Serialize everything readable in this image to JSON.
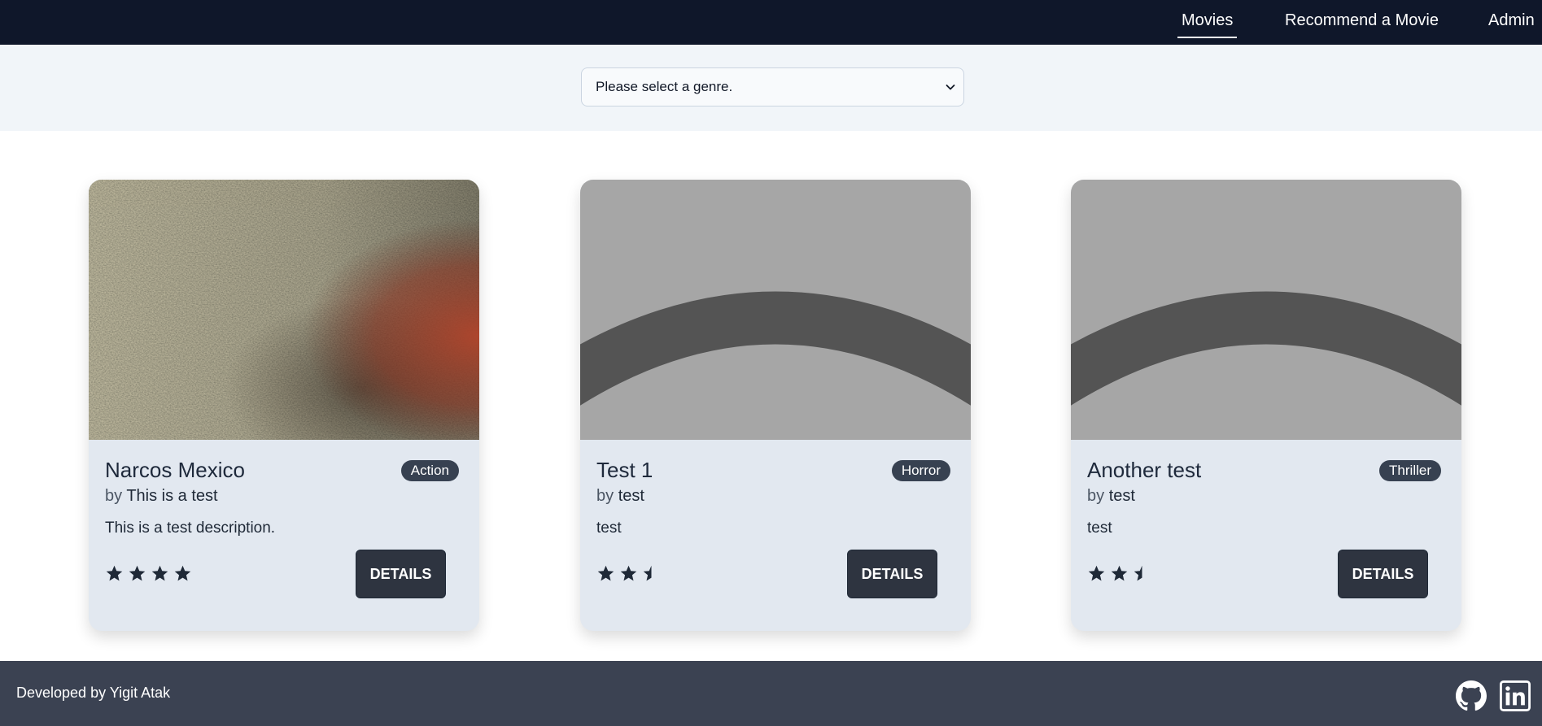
{
  "nav": {
    "items": [
      {
        "label": "Movies",
        "active": true
      },
      {
        "label": "Recommend a Movie",
        "active": false
      },
      {
        "label": "Admin",
        "active": false
      }
    ]
  },
  "filter": {
    "selected": "Please select a genre."
  },
  "movies": [
    {
      "title": "Narcos Mexico",
      "genre": "Action",
      "by_prefix": "by",
      "author": "This is a test",
      "description": "This is a test description.",
      "rating": 4,
      "details_label": "DETAILS",
      "poster": "fabric-texture-photo"
    },
    {
      "title": "Test 1",
      "genre": "Horror",
      "by_prefix": "by",
      "author": "test",
      "description": "test",
      "rating": 2.5,
      "details_label": "DETAILS",
      "poster": "placeholder-image"
    },
    {
      "title": "Another test",
      "genre": "Thriller",
      "by_prefix": "by",
      "author": "test",
      "description": "test",
      "rating": 2.5,
      "details_label": "DETAILS",
      "poster": "placeholder-image"
    }
  ],
  "footer": {
    "credit": "Developed by Yigit Atak",
    "icons": [
      "github-icon",
      "linkedin-icon"
    ]
  },
  "colors": {
    "navbar": "#0f172a",
    "filter_bar": "#f1f5f9",
    "card": "#e2e8f0",
    "badge": "#374151",
    "button": "#2e3440",
    "footer": "#3b4252",
    "star": "#1f2937"
  }
}
